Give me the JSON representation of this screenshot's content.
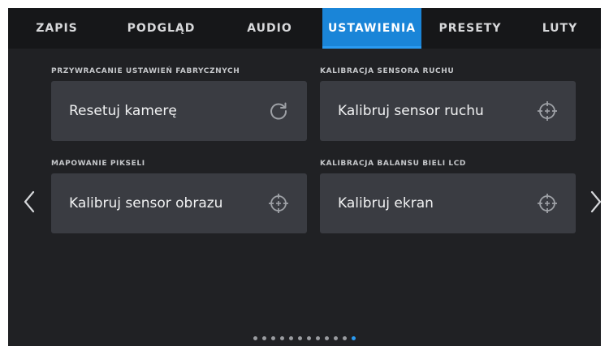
{
  "tabs": [
    {
      "label": "ZAPIS",
      "active": false
    },
    {
      "label": "PODGLĄD",
      "active": false
    },
    {
      "label": "AUDIO",
      "active": false
    },
    {
      "label": "USTAWIENIA",
      "active": true
    },
    {
      "label": "PRESETY",
      "active": false
    },
    {
      "label": "LUTY",
      "active": false
    }
  ],
  "sections": [
    {
      "title": "PRZYWRACANIE USTAWIEŃ FABRYCZNYCH",
      "button_label": "Resetuj kamerę",
      "icon": "reset-icon"
    },
    {
      "title": "KALIBRACJA SENSORA RUCHU",
      "button_label": "Kalibruj sensor ruchu",
      "icon": "crosshair-icon"
    },
    {
      "title": "MAPOWANIE PIKSELI",
      "button_label": "Kalibruj sensor obrazu",
      "icon": "crosshair-icon"
    },
    {
      "title": "KALIBRACJA BALANSU BIELI LCD",
      "button_label": "Kalibruj ekran",
      "icon": "crosshair-icon"
    }
  ],
  "navigation": {
    "prev_icon": "chevron-left-icon",
    "next_icon": "chevron-right-icon"
  },
  "pagination": {
    "total_pages": 12,
    "current_page": 12
  },
  "colors": {
    "accent": "#1a85d8",
    "card": "#3a3c42",
    "background": "#202124",
    "tabbar": "#161719"
  }
}
